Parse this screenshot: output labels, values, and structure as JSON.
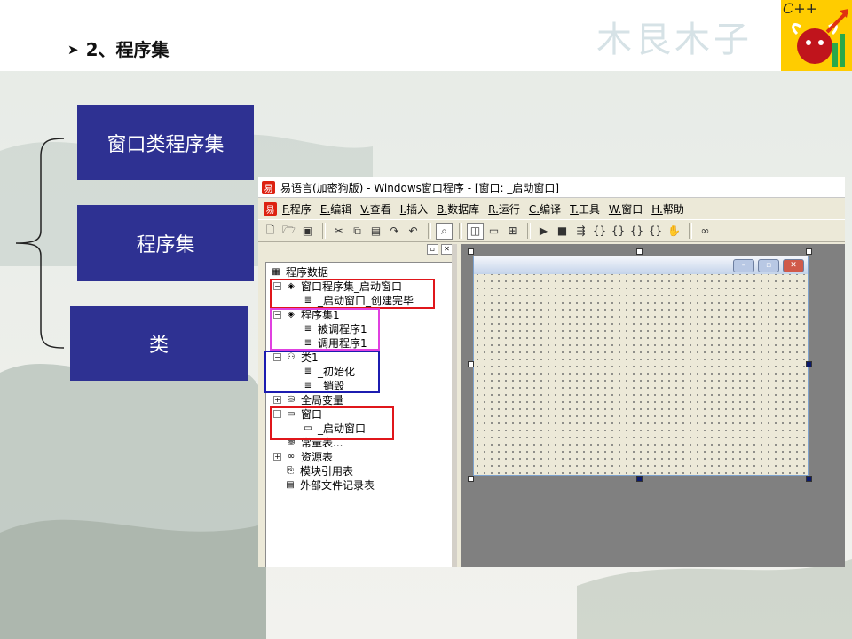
{
  "slide": {
    "bullet": "2、程序集",
    "watermark": "木艮木子",
    "logo_text": "C++"
  },
  "labels": [
    "窗口类程序集",
    "程序集",
    "类"
  ],
  "ide": {
    "title": "易语言(加密狗版) - Windows窗口程序 - [窗口: _启动窗口]",
    "menu": [
      {
        "key": "F.",
        "label": "程序"
      },
      {
        "key": "E.",
        "label": "编辑"
      },
      {
        "key": "V.",
        "label": "查看"
      },
      {
        "key": "I.",
        "label": "插入"
      },
      {
        "key": "B.",
        "label": "数据库"
      },
      {
        "key": "R.",
        "label": "运行"
      },
      {
        "key": "C.",
        "label": "编译"
      },
      {
        "key": "T.",
        "label": "工具"
      },
      {
        "key": "W.",
        "label": "窗口"
      },
      {
        "key": "H.",
        "label": "帮助"
      }
    ],
    "toolbar_icons": [
      "new-file-icon",
      "open-folder-icon",
      "save-icon",
      "sep",
      "cut-icon",
      "copy-icon",
      "paste-icon",
      "redo-icon",
      "undo-icon",
      "sep",
      "find-icon",
      "sep",
      "layout-icon-1",
      "layout-icon-2",
      "layout-icon-3",
      "sep",
      "run-icon",
      "stop-icon",
      "step-icon",
      "step-into-icon",
      "step-over-icon",
      "step-out-icon",
      "run-to-cursor-icon",
      "hand-icon",
      "sep",
      "binoculars-icon"
    ],
    "tree": {
      "root": "程序数据",
      "items": [
        "窗口程序集_启动窗口",
        "_启动窗口_创建完毕",
        "程序集1",
        "被调程序1",
        "调用程序1",
        "类1",
        "_初始化",
        "_销毁",
        "全局变量",
        "窗口",
        "_启动窗口",
        "常量表...",
        "资源表",
        "模块引用表",
        "外部文件记录表"
      ]
    },
    "highlight_colors": {
      "red": "#e0161b",
      "magenta": "#e040e0",
      "blue": "#1c1cb0"
    }
  },
  "colors": {
    "label_box": "#2e3192",
    "logo_bg": "#ffcc00"
  }
}
